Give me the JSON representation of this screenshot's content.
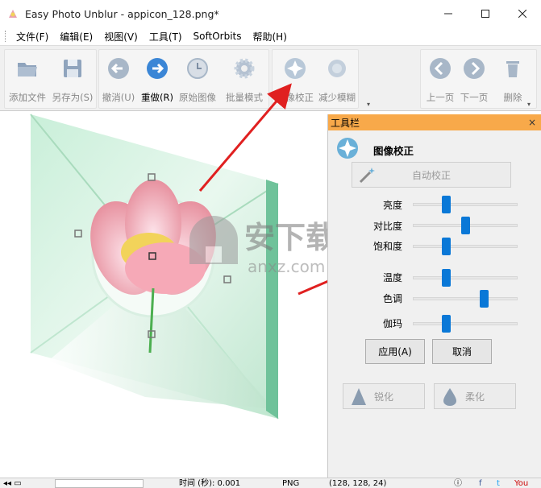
{
  "window": {
    "title": "Easy Photo Unblur - appicon_128.png*",
    "minimize_icon": "minimize-icon",
    "maximize_icon": "maximize-icon",
    "close_icon": "close-icon"
  },
  "menu": {
    "items": [
      "文件(F)",
      "编辑(E)",
      "视图(V)",
      "工具(T)",
      "SoftOrbits",
      "帮助(H)"
    ]
  },
  "toolbar": {
    "add_file": "添加文件",
    "save_as": "另存为(S)",
    "undo": "撤消(U)",
    "redo": "重做(R)",
    "original": "原始图像",
    "batch": "批量模式",
    "correct": "图像校正",
    "reduce_blur": "减少模糊",
    "prev_page": "上一页",
    "next_page": "下一页",
    "delete": "删除"
  },
  "panel": {
    "title": "工具栏",
    "close": "×",
    "section_title": "图像校正",
    "auto_correct": "自动校正",
    "sliders": [
      {
        "label": "亮度",
        "value": 0.32
      },
      {
        "label": "对比度",
        "value": 0.5
      },
      {
        "label": "饱和度",
        "value": 0.32
      },
      {
        "label": "温度",
        "value": 0.32
      },
      {
        "label": "色调",
        "value": 0.68
      },
      {
        "label": "伽玛",
        "value": 0.32
      }
    ],
    "apply": "应用(A)",
    "cancel": "取消",
    "sharpen": "锐化",
    "soften": "柔化"
  },
  "status": {
    "zoom_text": "时间 (秒): 0.001",
    "format": "PNG",
    "dimensions": "(128, 128, 24)"
  },
  "watermark": {
    "text": "安下载",
    "url": "anxz.com"
  },
  "colors": {
    "accent": "#0a78d7",
    "panel_header": "#f8a94a",
    "arrow": "#e02020"
  }
}
